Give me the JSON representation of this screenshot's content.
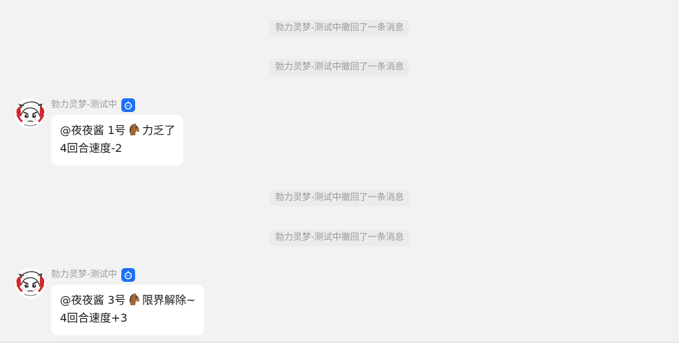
{
  "system_notices": [
    "勃力灵梦-测试中撤回了一条消息",
    "勃力灵梦-测试中撤回了一条消息",
    "勃力灵梦-测试中撤回了一条消息",
    "勃力灵梦-测试中撤回了一条消息"
  ],
  "messages": [
    {
      "sender": "勃力灵梦-测试中",
      "badge_icon": "bot-badge-icon",
      "line1_prefix": "@夜夜酱 1号",
      "line1_emoji": "horse-face",
      "line1_suffix": "力乏了",
      "line2": "4回合速度-2"
    },
    {
      "sender": "勃力灵梦-测试中",
      "badge_icon": "bot-badge-icon",
      "line1_prefix": "@夜夜酱 3号",
      "line1_emoji": "horse-face",
      "line1_suffix": "限界解除~",
      "line2": "4回合速度+3"
    }
  ],
  "colors": {
    "background": "#f2f2f2",
    "notice_text": "#999999",
    "bubble": "#ffffff",
    "badge": "#1b6ff5"
  }
}
